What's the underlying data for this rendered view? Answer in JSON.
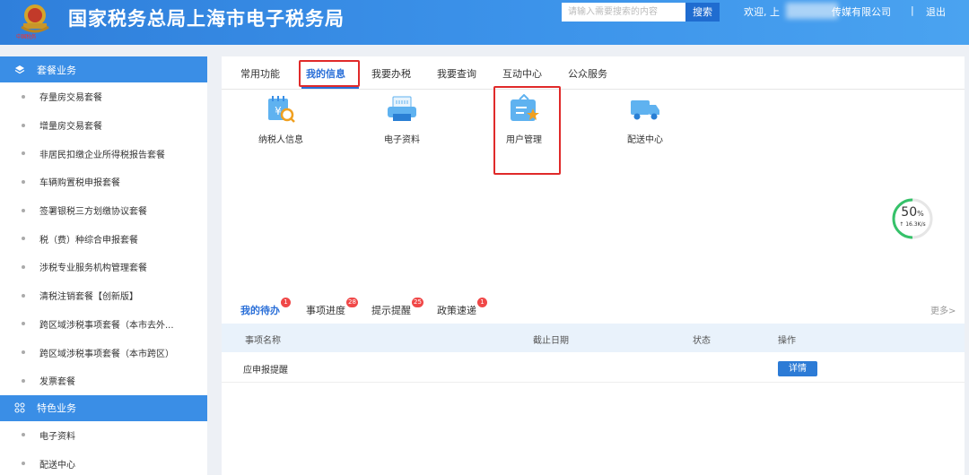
{
  "header": {
    "site_title": "国家税务总局上海市电子税务局",
    "emblem_text": "中国税务",
    "search_placeholder": "请输入需要搜索的内容",
    "search_button": "搜索",
    "welcome_prefix": "欢迎, 上",
    "company_suffix": "传媒有限公司",
    "separator": "|",
    "logout": "退出"
  },
  "sidebar": {
    "group1": "套餐业务",
    "items1": [
      "存量房交易套餐",
      "增量房交易套餐",
      "非居民扣缴企业所得税报告套餐",
      "车辆购置税申报套餐",
      "签署银税三方划缴协议套餐",
      "税（费）种综合申报套餐",
      "涉税专业服务机构管理套餐",
      "清税注销套餐【创新版】",
      "跨区域涉税事项套餐（本市去外...",
      "跨区域涉税事项套餐（本市跨区）",
      "发票套餐"
    ],
    "group2": "特色业务",
    "items2": [
      "电子资料",
      "配送中心"
    ]
  },
  "tabs": [
    "常用功能",
    "我的信息",
    "我要办税",
    "我要查询",
    "互动中心",
    "公众服务"
  ],
  "services": [
    "纳税人信息",
    "电子资料",
    "用户管理",
    "配送中心"
  ],
  "progress": {
    "percent": "50",
    "unit": "%",
    "speed": "↑ 16.3K/s",
    "value": 0.5
  },
  "bottom_tabs": [
    {
      "label": "我的待办",
      "badge": "1"
    },
    {
      "label": "事项进度",
      "badge": "28"
    },
    {
      "label": "提示提醒",
      "badge": "25"
    },
    {
      "label": "政策速递",
      "badge": "1"
    }
  ],
  "more": "更多>",
  "table": {
    "headers": [
      "事项名称",
      "截止日期",
      "状态",
      "操作"
    ],
    "rows": [
      {
        "name": "应申报提醒",
        "action": "详情"
      }
    ]
  },
  "colors": {
    "accent": "#2a6fd8",
    "header": "#3c93ea",
    "highlight_box": "#e02a2a",
    "badge": "#f04848"
  }
}
